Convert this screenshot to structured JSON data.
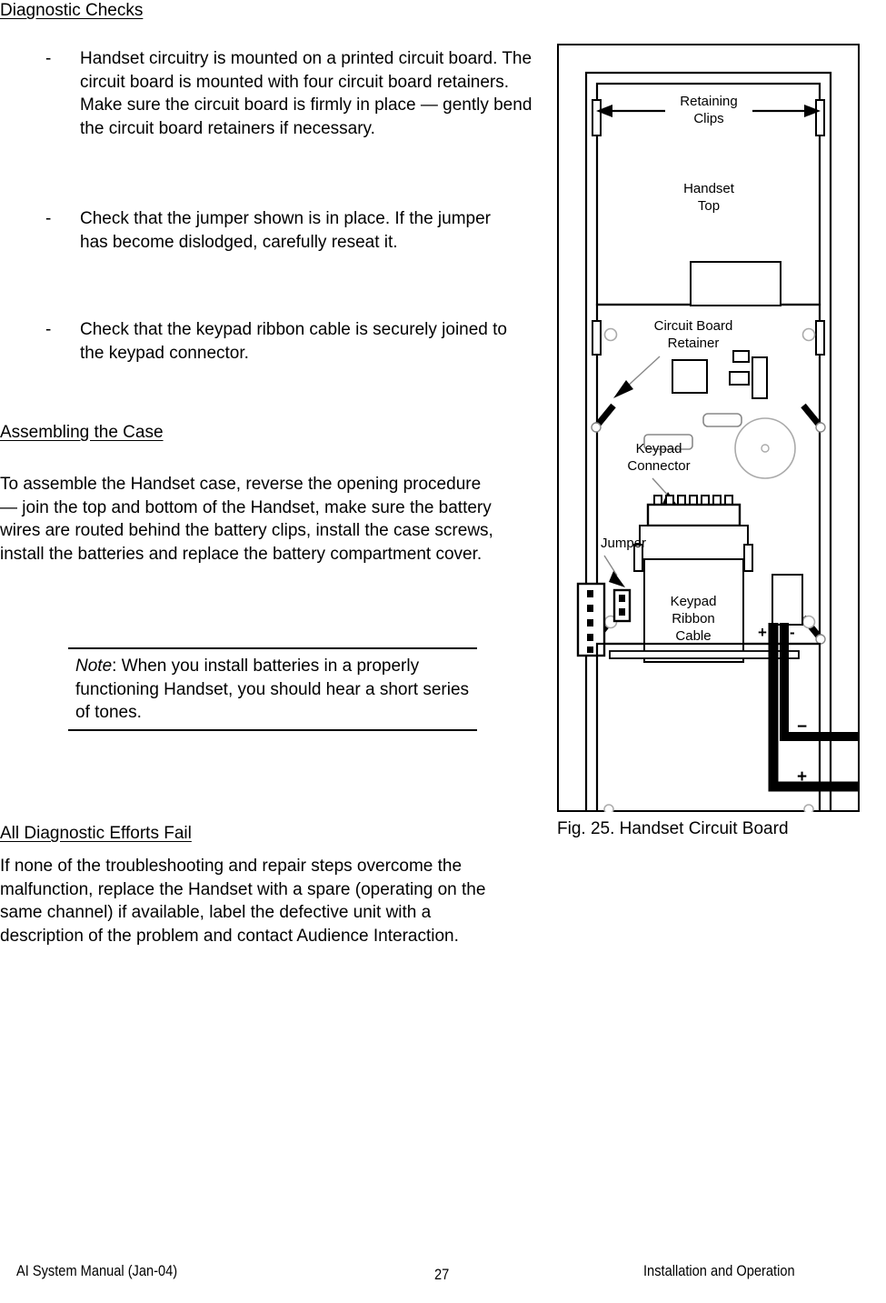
{
  "document": {
    "page_number": "27",
    "footer_left": "AI System Manual (Jan-04)",
    "footer_right": "Installation and Operation"
  },
  "sections": {
    "diagnostic_checks": {
      "heading": "Diagnostic Checks",
      "bullet_mark": "-",
      "bullets": [
        "Handset circuitry is mounted on a printed circuit board.  The circuit board is mounted with four circuit board retainers.  Make sure the circuit board is firmly in place — gently bend the circuit board retainers if necessary.",
        "Check that the jumper shown is in place. If the jumper has become dislodged, carefully reseat it.",
        "Check that the keypad ribbon cable is securely joined to the keypad connector."
      ]
    },
    "assembling_the_case": {
      "heading": "Assembling the Case",
      "body": "To assemble the Handset case, reverse the opening procedure — join the top and bottom of the Handset, make sure the battery wires are routed behind the battery clips, install the case screws, install the batteries and replace the battery compartment cover.",
      "note": {
        "label": "Note",
        "text": ":  When you install batteries in a properly functioning Handset, you should hear a short series of tones."
      }
    },
    "all_diagnostic_efforts_fail": {
      "heading": "All Diagnostic Efforts Fail",
      "body": "If none of the troubleshooting and repair steps overcome the malfunction, replace the Handset with a spare (operating on the same channel) if available, label the defective unit with a description of the problem and contact Audience Interaction."
    }
  },
  "figure": {
    "caption": "Fig. 25.  Handset Circuit Board",
    "labels": {
      "retaining_clips_line1": "Retaining",
      "retaining_clips_line2": "Clips",
      "handset_top_line1": "Handset",
      "handset_top_line2": "Top",
      "circuit_board_retainer_line1": "Circuit Board",
      "circuit_board_retainer_line2": "Retainer",
      "keypad_connector_line1": "Keypad",
      "keypad_connector_line2": "Connector",
      "jumper": "Jumper",
      "keypad_ribbon_cable_line1": "Keypad",
      "keypad_ribbon_cable_line2": "Ribbon",
      "keypad_ribbon_cable_line3": "Cable",
      "battery_plus_terminal": "+",
      "battery_minus_terminal": "-",
      "wire_negative": "−",
      "wire_positive": "+"
    },
    "colors": {
      "line": "#000000",
      "light_line": "#999999",
      "background": "#ffffff"
    }
  }
}
